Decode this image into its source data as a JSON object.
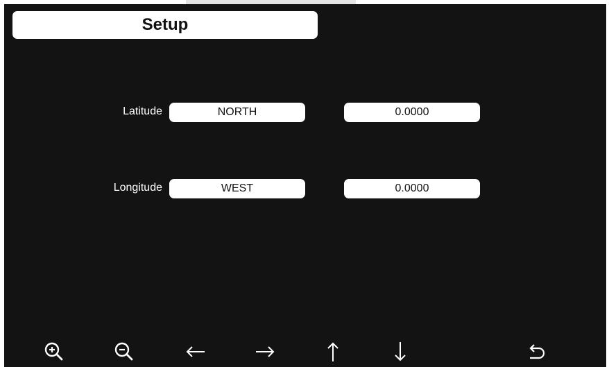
{
  "header": {
    "title": "Setup"
  },
  "location": {
    "latitude": {
      "label": "Latitude",
      "direction": "NORTH",
      "value": "0.0000"
    },
    "longitude": {
      "label": "Longitude",
      "direction": "WEST",
      "value": "0.0000"
    }
  },
  "toolbar": {
    "icons": [
      "zoom-in-icon",
      "zoom-out-icon",
      "arrow-left-icon",
      "arrow-right-icon",
      "arrow-up-icon",
      "arrow-down-icon",
      "return-icon"
    ]
  },
  "colors": {
    "background": "#131313",
    "field": "#ffffff",
    "text_dark": "#111111",
    "text_light": "#ffffff"
  }
}
